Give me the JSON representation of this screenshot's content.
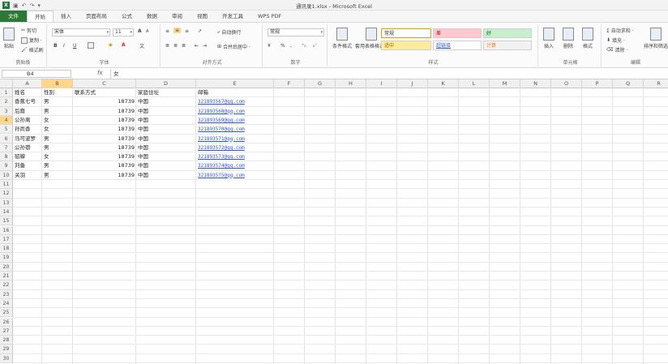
{
  "window": {
    "title": "通讯录1.xlsx - Microsoft Excel"
  },
  "tabs": [
    {
      "label": "文件"
    },
    {
      "label": "开始"
    },
    {
      "label": "插入"
    },
    {
      "label": "页面布局"
    },
    {
      "label": "公式"
    },
    {
      "label": "数据"
    },
    {
      "label": "审阅"
    },
    {
      "label": "视图"
    },
    {
      "label": "开发工具"
    },
    {
      "label": "WPS PDF"
    }
  ],
  "ribbon": {
    "clipboard": {
      "label": "剪贴板",
      "paste": "粘贴",
      "cut": "剪切",
      "copy": "复制 ·",
      "format_painter": "格式刷"
    },
    "font": {
      "label": "字体",
      "name": "宋体",
      "size": "11",
      "grow": "A",
      "shrink": "A",
      "bold": "B",
      "italic": "I",
      "underline": "U",
      "color_a": "A",
      "phonetic": "文"
    },
    "alignment": {
      "label": "对齐方式",
      "wrap": "自动换行",
      "merge": "合并后居中 ·"
    },
    "number": {
      "label": "数字",
      "format": "常规",
      "percent": "%",
      "comma": ","
    },
    "styles": {
      "label": "样式",
      "conditional": "条件格式",
      "table": "套用表格格式 ·",
      "cells": [
        {
          "text": "常规"
        },
        {
          "text": "差"
        },
        {
          "text": "好"
        },
        {
          "text": "适中"
        },
        {
          "text": "超链接"
        },
        {
          "text": "计算"
        }
      ]
    },
    "cells_group": {
      "label": "单元格",
      "insert": "插入",
      "delete": "删除",
      "format": "格式"
    },
    "editing": {
      "label": "编辑",
      "autosum": "Σ 自动求和 ·",
      "fill": "填充 ·",
      "clear": "清除 ·",
      "sort": "排序和筛选"
    }
  },
  "formula_bar": {
    "name_box": "B4",
    "fx": "fx",
    "value": "女"
  },
  "grid": {
    "columns": [
      "A",
      "B",
      "C",
      "D",
      "E",
      "F",
      "G",
      "H",
      "I",
      "J",
      "K",
      "L",
      "M",
      "N",
      "O",
      "P",
      "Q",
      "R"
    ],
    "selected_column": "B",
    "selected_row": 4,
    "row_count": 30,
    "header": [
      "姓名",
      "性别",
      "联系方式",
      "家庭住址",
      "邮箱"
    ],
    "rows": [
      {
        "name": "香蕉七号",
        "gender": "男",
        "phone": "18739",
        "addr": "中国",
        "email": "321893567@qq.com"
      },
      {
        "name": "后裔",
        "gender": "男",
        "phone": "18739",
        "addr": "中国",
        "email": "321893568@qq.com"
      },
      {
        "name": "公孙离",
        "gender": "女",
        "phone": "18739",
        "addr": "中国",
        "email": "321893569@qq.com"
      },
      {
        "name": "孙尚香",
        "gender": "女",
        "phone": "18739",
        "addr": "中国",
        "email": "321893570@qq.com"
      },
      {
        "name": "马可波罗",
        "gender": "男",
        "phone": "18739",
        "addr": "中国",
        "email": "321893571@qq.com"
      },
      {
        "name": "公孙瓒",
        "gender": "男",
        "phone": "18739",
        "addr": "中国",
        "email": "321893572@qq.com"
      },
      {
        "name": "貂蝉",
        "gender": "女",
        "phone": "18739",
        "addr": "中国",
        "email": "321893573@qq.com"
      },
      {
        "name": "刘备",
        "gender": "男",
        "phone": "18739",
        "addr": "中国",
        "email": "321893574@qq.com"
      },
      {
        "name": "关羽",
        "gender": "男",
        "phone": "18739",
        "addr": "中国",
        "email": "321893575@qq.com"
      }
    ]
  },
  "colors": {
    "file_tab": "#2a7a36",
    "bad_fill": "#ffc7ce",
    "good_fill": "#c6efce",
    "neutral_fill": "#ffeb9c",
    "link": "#2f55d4",
    "selection_header": "#ffd68a"
  }
}
